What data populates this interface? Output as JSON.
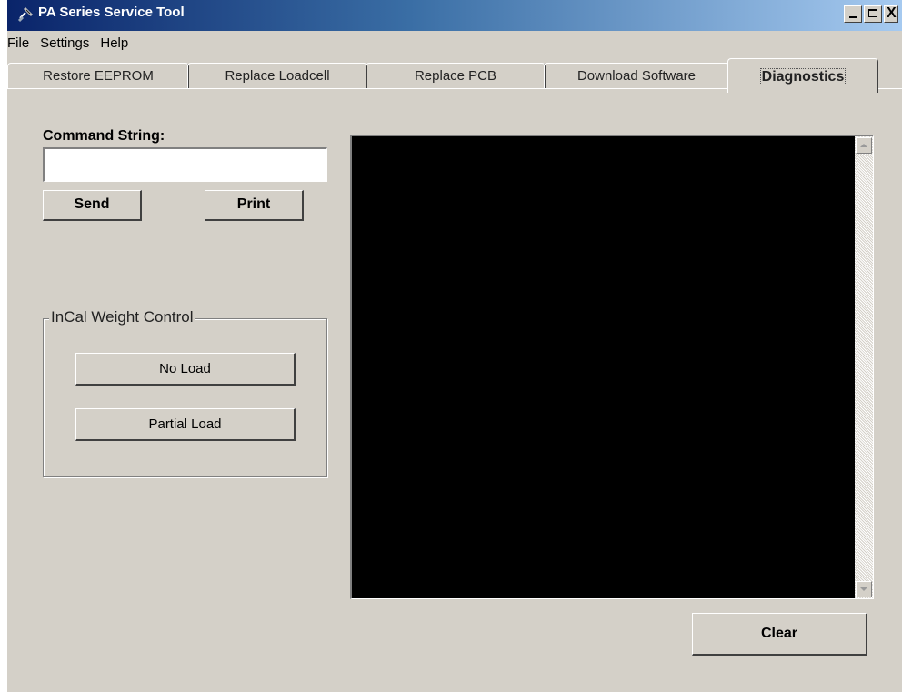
{
  "window": {
    "title": "PA Series Service Tool",
    "icon": "satellite-dish-icon",
    "controls": {
      "minimize": "minimize-icon",
      "maximize": "maximize-icon",
      "close_glyph": "X"
    }
  },
  "menu": {
    "items": [
      "File",
      "Settings",
      "Help"
    ]
  },
  "tabs": {
    "items": [
      "Restore EEPROM",
      "Replace Loadcell",
      "Replace PCB",
      "Download Software",
      "Diagnostics"
    ],
    "active": "Diagnostics"
  },
  "diagnostics": {
    "command_label": "Command String:",
    "command_value": "",
    "send_label": "Send",
    "print_label": "Print",
    "incal": {
      "title": "InCal Weight Control",
      "no_load_label": "No Load",
      "partial_load_label": "Partial Load"
    },
    "output_text": "",
    "clear_label": "Clear"
  },
  "colors": {
    "titlebar_start": "#0a246a",
    "titlebar_end": "#a6caf0",
    "face": "#d4d0c8",
    "console_bg": "#000000"
  }
}
